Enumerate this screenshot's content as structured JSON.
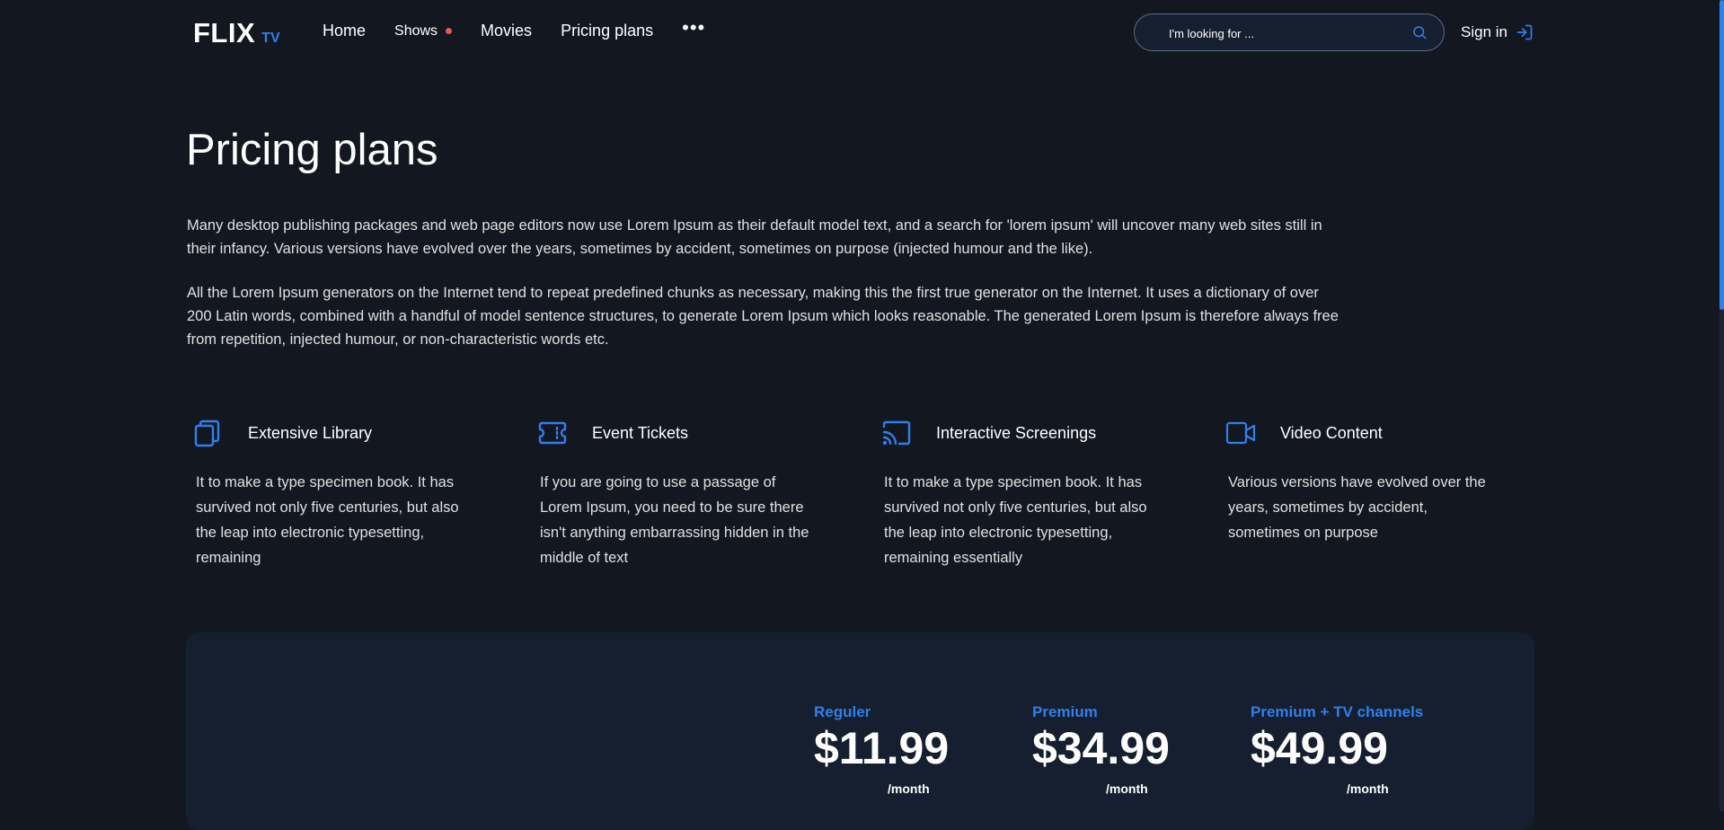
{
  "header": {
    "logo": {
      "main": "FLIX",
      "sub": "TV"
    },
    "nav": [
      {
        "label": "Home"
      },
      {
        "label": "Shows",
        "has_dot": true
      },
      {
        "label": "Movies"
      },
      {
        "label": "Pricing plans"
      }
    ],
    "more_icon": "more-dots-icon",
    "search": {
      "placeholder": "I'm looking for ...",
      "icon": "search-icon"
    },
    "signin": {
      "label": "Sign in",
      "icon": "sign-in-icon"
    }
  },
  "main": {
    "title": "Pricing plans",
    "paragraphs": [
      "Many desktop publishing packages and web page editors now use Lorem Ipsum as their default model text, and a search for 'lorem ipsum' will uncover many web sites still in their infancy. Various versions have evolved over the years, sometimes by accident, sometimes on purpose (injected humour and the like).",
      "All the Lorem Ipsum generators on the Internet tend to repeat predefined chunks as necessary, making this the first true generator on the Internet. It uses a dictionary of over 200 Latin words, combined with a handful of model sentence structures, to generate Lorem Ipsum which looks reasonable. The generated Lorem Ipsum is therefore always free from repetition, injected humour, or non-characteristic words etc."
    ],
    "features": [
      {
        "icon": "library-icon",
        "title": "Extensive Library",
        "text": "It to make a type specimen book. It has survived not only five centuries, but also the leap into electronic typesetting, remaining"
      },
      {
        "icon": "ticket-icon",
        "title": "Event Tickets",
        "text": "If you are going to use a passage of Lorem Ipsum, you need to be sure there isn't anything embarrassing hidden in the middle of text"
      },
      {
        "icon": "cast-icon",
        "title": "Interactive Screenings",
        "text": "It to make a type specimen book. It has survived not only five centuries, but also the leap into electronic typesetting, remaining essentially"
      },
      {
        "icon": "video-camera-icon",
        "title": "Video Content",
        "text": "Various versions have evolved over the years, sometimes by accident, sometimes on purpose"
      }
    ],
    "plans": [
      {
        "name": "Reguler",
        "price": "$11.99",
        "period": "/month"
      },
      {
        "name": "Premium",
        "price": "$34.99",
        "period": "/month"
      },
      {
        "name": "Premium + TV channels",
        "price": "$49.99",
        "period": "/month"
      }
    ]
  },
  "colors": {
    "background": "#131720",
    "panel": "#151f30",
    "accent": "#2f80ed",
    "notification_dot": "#eb5757",
    "text": "#ffffff"
  }
}
